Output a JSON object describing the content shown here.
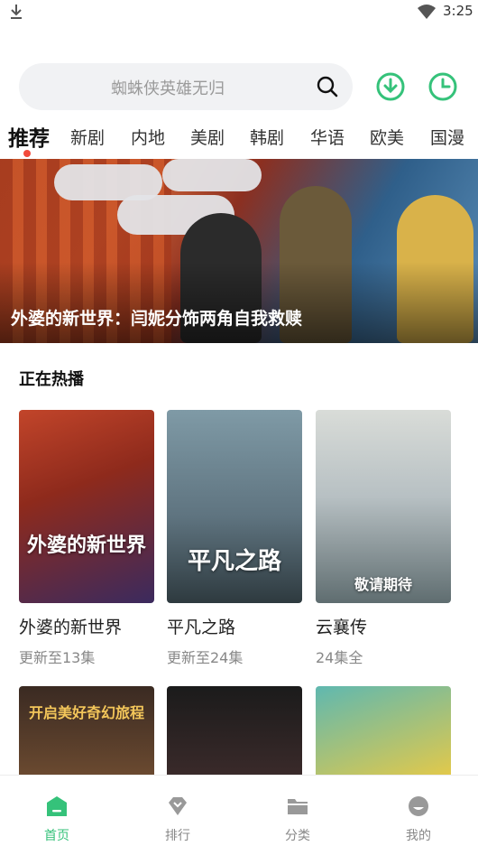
{
  "status_bar": {
    "time": "3:25",
    "icons": [
      "download-icon",
      "wifi-icon"
    ]
  },
  "search": {
    "placeholder": "蜘蛛侠英雄无归"
  },
  "top_actions": {
    "download_icon": "download-circle-icon",
    "history_icon": "clock-icon",
    "accent": "#35c27a"
  },
  "tabs": [
    {
      "label": "推荐",
      "active": true
    },
    {
      "label": "新剧"
    },
    {
      "label": "内地"
    },
    {
      "label": "美剧"
    },
    {
      "label": "韩剧"
    },
    {
      "label": "华语"
    },
    {
      "label": "欧美"
    },
    {
      "label": "国漫"
    }
  ],
  "banner": {
    "caption": "外婆的新世界：闫妮分饰两角自我救赎"
  },
  "hot": {
    "title": "正在热播",
    "items": [
      {
        "name": "外婆的新世界",
        "sub": "更新至13集",
        "poster_text": "外婆的新世界"
      },
      {
        "name": "平凡之路",
        "sub": "更新至24集",
        "poster_text": "平凡之路"
      },
      {
        "name": "云襄传",
        "sub": "24集全",
        "poster_text": "敬请期待"
      }
    ],
    "row2_poster_texts": [
      "开启美好奇幻旅程",
      "",
      ""
    ]
  },
  "bottom_nav": [
    {
      "label": "首页",
      "icon": "home-icon",
      "active": true
    },
    {
      "label": "排行",
      "icon": "rank-icon"
    },
    {
      "label": "分类",
      "icon": "folder-icon"
    },
    {
      "label": "我的",
      "icon": "profile-icon"
    }
  ]
}
